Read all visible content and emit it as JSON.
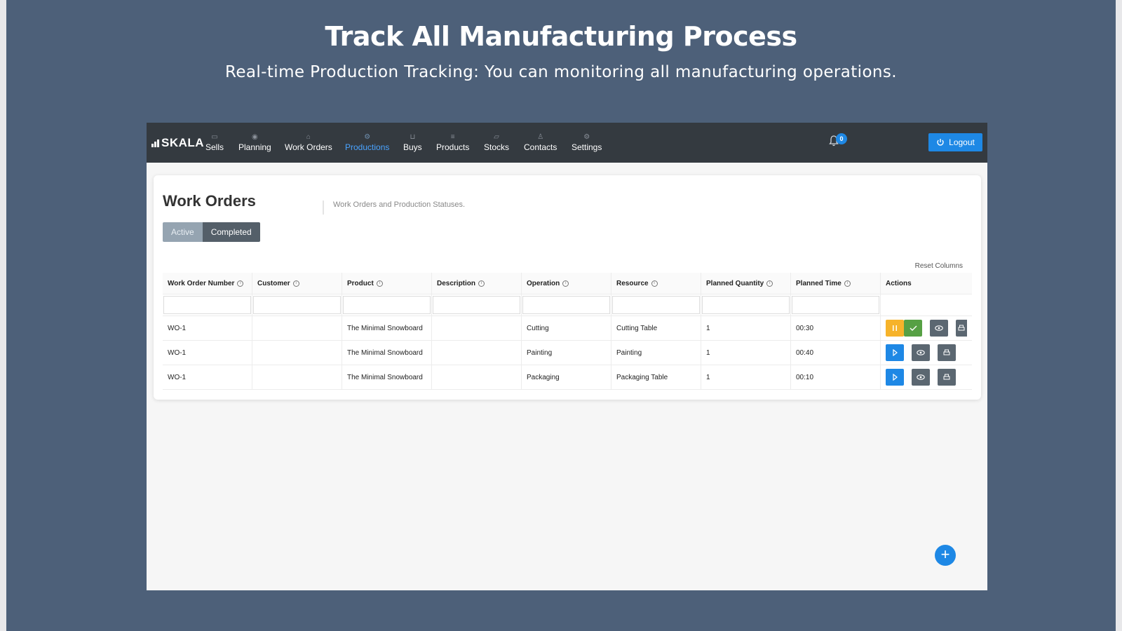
{
  "hero": {
    "title": "Track All Manufacturing Process",
    "subtitle": "Real-time Production Tracking: You can monitoring all manufacturing operations."
  },
  "app": {
    "logo": "SKALA",
    "nav": [
      {
        "label": "Sells",
        "icon": "wallet-icon"
      },
      {
        "label": "Planning",
        "icon": "eye-icon"
      },
      {
        "label": "Work Orders",
        "icon": "inbox-icon"
      },
      {
        "label": "Productions",
        "icon": "gear-icon"
      },
      {
        "label": "Buys",
        "icon": "cart-icon"
      },
      {
        "label": "Products",
        "icon": "list-icon"
      },
      {
        "label": "Stocks",
        "icon": "folder-icon"
      },
      {
        "label": "Contacts",
        "icon": "user-icon"
      },
      {
        "label": "Settings",
        "icon": "settings-icon"
      }
    ],
    "active_nav": "Productions",
    "notifications": "0",
    "logout": "Logout",
    "accent": "#1e88e5"
  },
  "page": {
    "title": "Work Orders",
    "description": "Work Orders and Production Statuses.",
    "tabs": {
      "active": "Active",
      "completed": "Completed"
    },
    "reset_columns": "Reset Columns"
  },
  "table": {
    "columns": [
      "Work Order Number",
      "Customer",
      "Product",
      "Description",
      "Operation",
      "Resource",
      "Planned Quantity",
      "Planned Time",
      "Actions"
    ],
    "rows": [
      {
        "wo": "WO-1",
        "customer": "",
        "product": "The Minimal Snowboard",
        "description": "",
        "operation": "Cutting",
        "resource": "Cutting Table",
        "qty": "1",
        "time": "00:30",
        "status": "running"
      },
      {
        "wo": "WO-1",
        "customer": "",
        "product": "The Minimal Snowboard",
        "description": "",
        "operation": "Painting",
        "resource": "Painting",
        "qty": "1",
        "time": "00:40",
        "status": "pending"
      },
      {
        "wo": "WO-1",
        "customer": "",
        "product": "The Minimal Snowboard",
        "description": "",
        "operation": "Packaging",
        "resource": "Packaging Table",
        "qty": "1",
        "time": "00:10",
        "status": "pending"
      }
    ]
  }
}
